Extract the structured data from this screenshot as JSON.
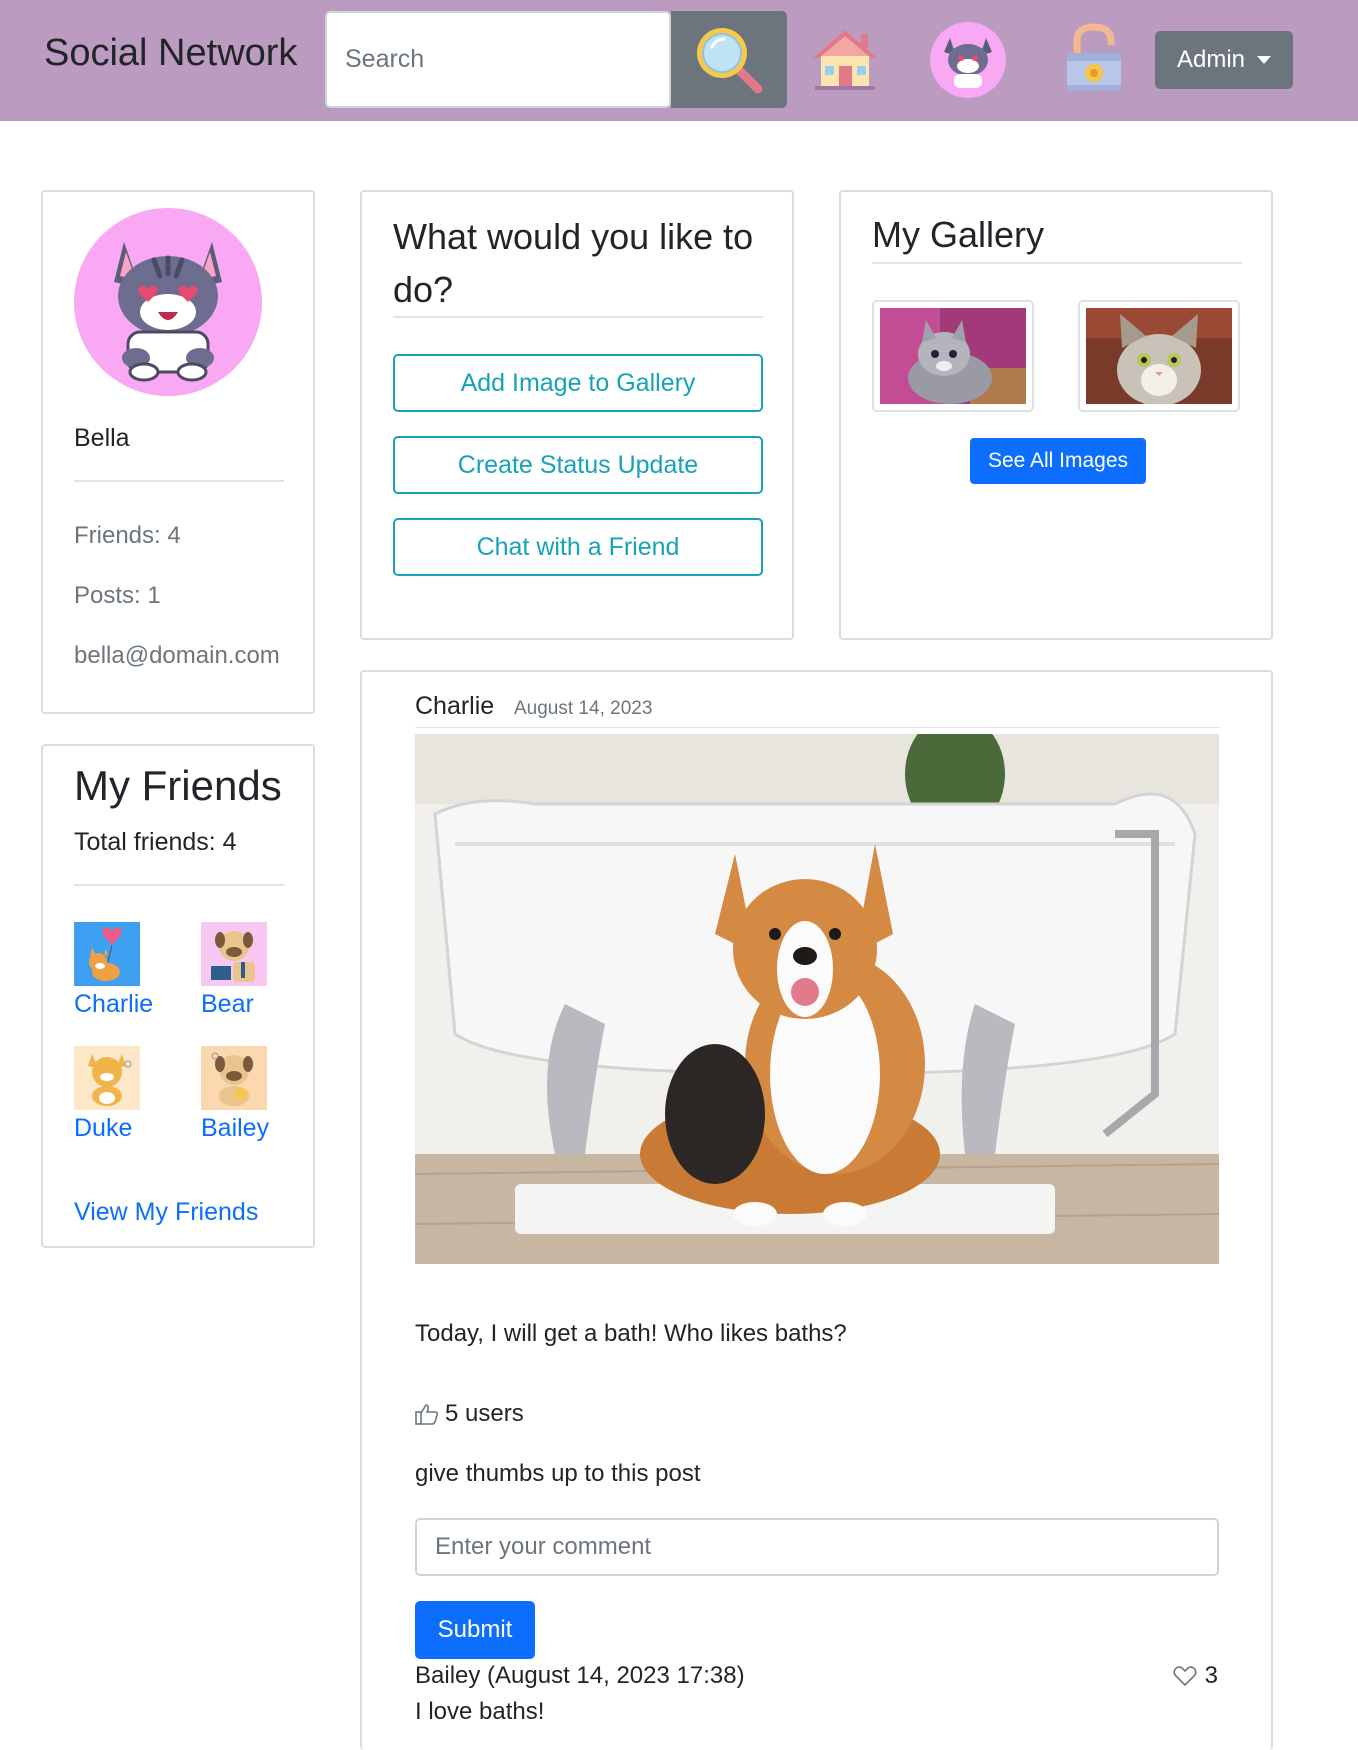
{
  "navbar": {
    "brand": "Social Network",
    "search_placeholder": "Search",
    "admin_label": "Admin",
    "icons": [
      "search-icon",
      "home-icon",
      "user-avatar-icon",
      "logout-lock-icon"
    ],
    "color": "#bb9bbf"
  },
  "profile": {
    "name": "Bella",
    "friends": "Friends: 4",
    "posts": "Posts: 1",
    "email": "bella@domain.com"
  },
  "friends_card": {
    "title": "My Friends",
    "total": "Total friends: 4",
    "items": [
      {
        "name": "Charlie"
      },
      {
        "name": "Bear"
      },
      {
        "name": "Duke"
      },
      {
        "name": "Bailey"
      }
    ],
    "view_link": "View My Friends"
  },
  "actions": {
    "title": "What would you like to do?",
    "buttons": [
      "Add Image to Gallery",
      "Create Status Update",
      "Chat with a Friend"
    ]
  },
  "gallery": {
    "title": "My Gallery",
    "see_all": "See All Images"
  },
  "post": {
    "author": "Charlie",
    "date": "August 14, 2023",
    "text": "Today, I will get a bath! Who likes baths?",
    "likes": "5 users",
    "thumbs_label": "give thumbs up to this post",
    "comment_placeholder": "Enter your comment",
    "submit": "Submit",
    "comment": {
      "meta": "Bailey (August 14, 2023 17:38)",
      "likes": "3",
      "text": "I love baths!"
    }
  },
  "colors": {
    "primary": "#0d6efd",
    "info": "#17a2b8",
    "secondary": "#6c757d"
  }
}
